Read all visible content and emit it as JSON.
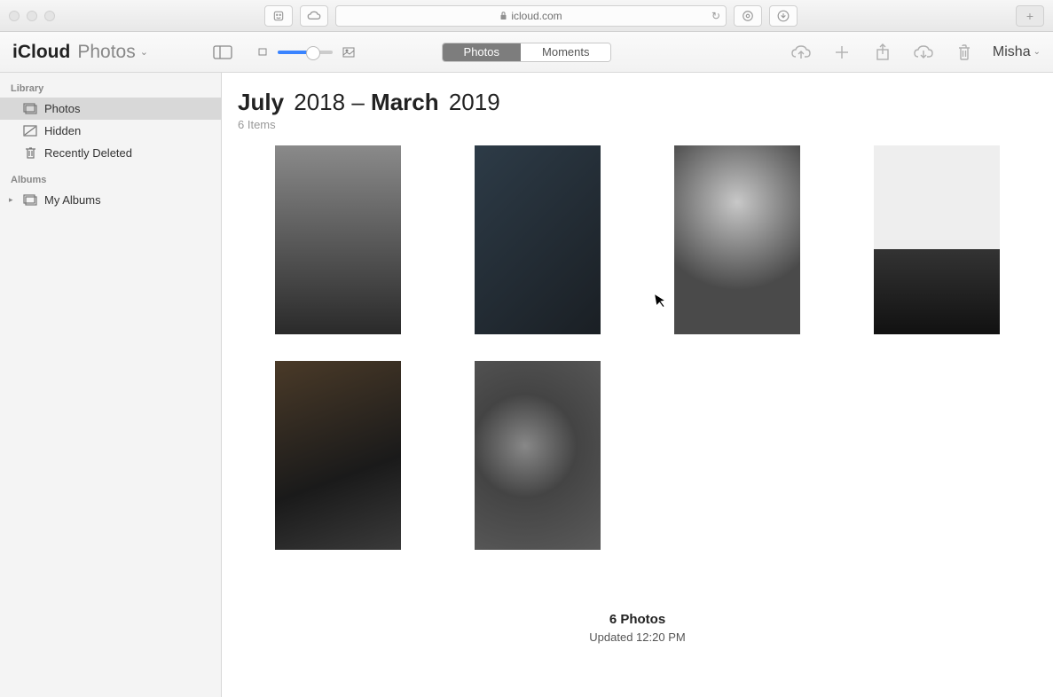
{
  "browser": {
    "url": "icloud.com"
  },
  "app": {
    "title_bold": "iCloud",
    "title_light": "Photos"
  },
  "segmented": {
    "photos": "Photos",
    "moments": "Moments"
  },
  "user": {
    "name": "Misha"
  },
  "sidebar": {
    "library_header": "Library",
    "albums_header": "Albums",
    "items": [
      {
        "label": "Photos"
      },
      {
        "label": "Hidden"
      },
      {
        "label": "Recently Deleted"
      }
    ],
    "my_albums": "My Albums"
  },
  "range": {
    "m1": "July",
    "y1": "2018",
    "sep": " – ",
    "m2": "March",
    "y2": "2019"
  },
  "item_count": "6 Items",
  "footer": {
    "count": "6 Photos",
    "updated": "Updated 12:20 PM"
  }
}
